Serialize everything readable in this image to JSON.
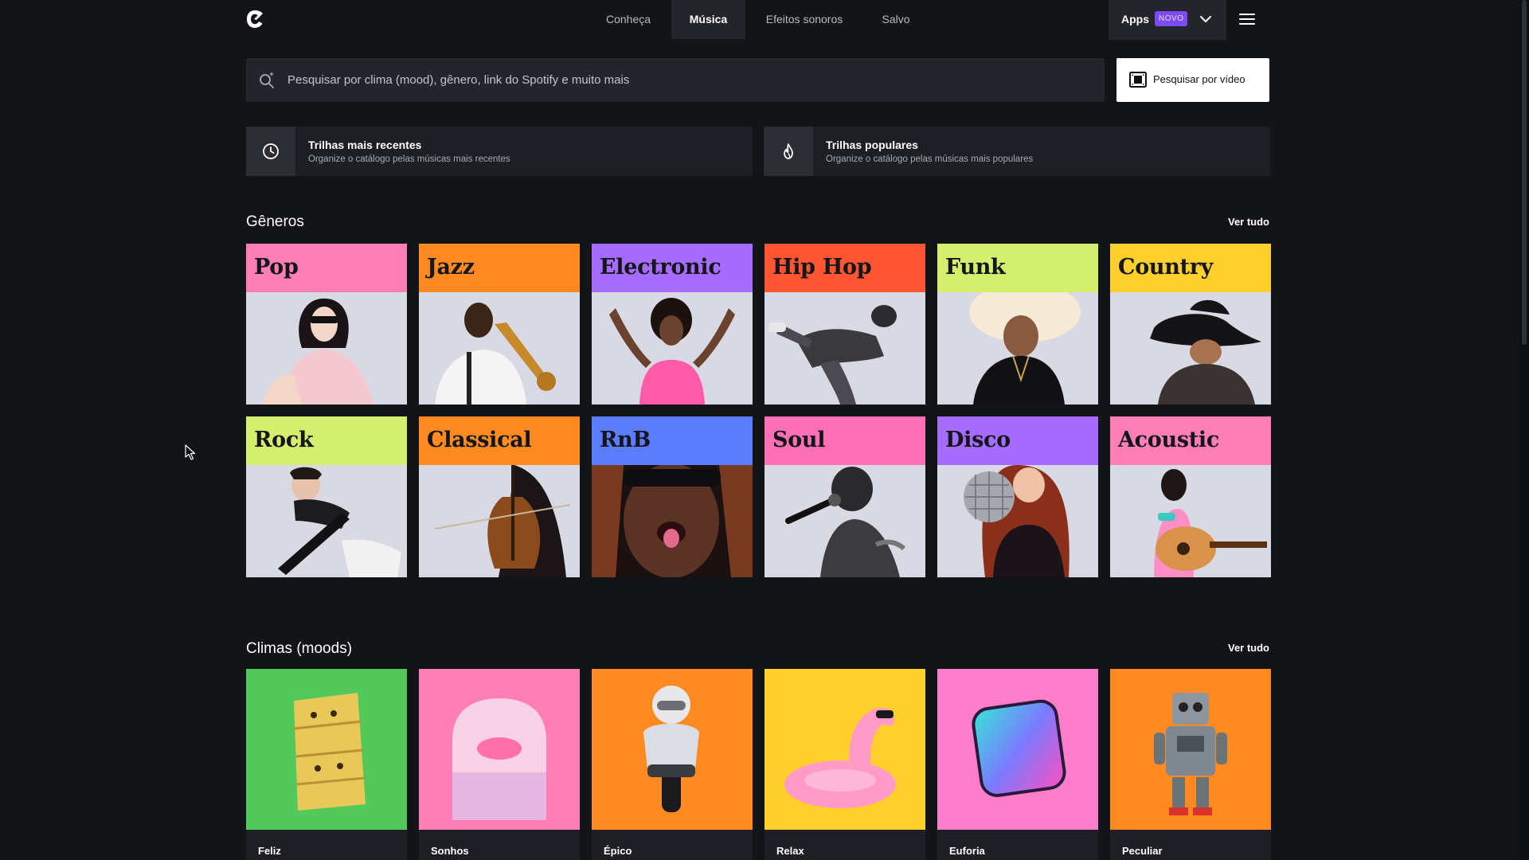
{
  "nav": {
    "items": [
      {
        "label": "Conheça"
      },
      {
        "label": "Música",
        "active": true
      },
      {
        "label": "Efeitos sonoros"
      },
      {
        "label": "Salvo"
      }
    ],
    "apps_label": "Apps",
    "apps_badge": "NOVO",
    "icons": {
      "logo": "brand-logo-icon",
      "apps_dropdown": "chevron-down-icon",
      "menu": "hamburger-menu-icon"
    }
  },
  "search": {
    "placeholder": "Pesquisar por clima (mood), gênero, link do Spotify e muito mais",
    "value": "",
    "icon": "ai-search-icon",
    "video_button_label": "Pesquisar por vídeo",
    "video_button_icon": "video-frame-icon"
  },
  "sort_cards": [
    {
      "title": "Trilhas mais recentes",
      "subtitle": "Organize o catálogo pelas músicas mais recentes",
      "icon": "clock-icon"
    },
    {
      "title": "Trilhas populares",
      "subtitle": "Organize o catálogo pelas músicas mais populares",
      "icon": "flame-icon"
    }
  ],
  "genres": {
    "title": "Gêneros",
    "see_all": "Ver tudo",
    "items": [
      {
        "name": "Pop",
        "color": "#ff7eb6"
      },
      {
        "name": "Jazz",
        "color": "#ff8a22"
      },
      {
        "name": "Electronic",
        "color": "#a66bff"
      },
      {
        "name": "Hip Hop",
        "color": "#ff5533"
      },
      {
        "name": "Funk",
        "color": "#d4ef6e"
      },
      {
        "name": "Country",
        "color": "#ffcf2e"
      },
      {
        "name": "Rock",
        "color": "#d4ef6e"
      },
      {
        "name": "Classical",
        "color": "#ff8a22"
      },
      {
        "name": "RnB",
        "color": "#5b7cff"
      },
      {
        "name": "Soul",
        "color": "#ff6fb5"
      },
      {
        "name": "Disco",
        "color": "#a66bff"
      },
      {
        "name": "Acoustic",
        "color": "#ff7eb6"
      }
    ]
  },
  "moods": {
    "title": "Climas (moods)",
    "see_all": "Ver tudo",
    "items": [
      {
        "name": "Feliz",
        "color": "#52c95a"
      },
      {
        "name": "Sonhos",
        "color": "#ff7eb6"
      },
      {
        "name": "Épico",
        "color": "#ff8a22"
      },
      {
        "name": "Relax",
        "color": "#ffcf2e"
      },
      {
        "name": "Euforia",
        "color": "#ff7ecb"
      },
      {
        "name": "Peculiar",
        "color": "#ff8a22"
      }
    ]
  }
}
